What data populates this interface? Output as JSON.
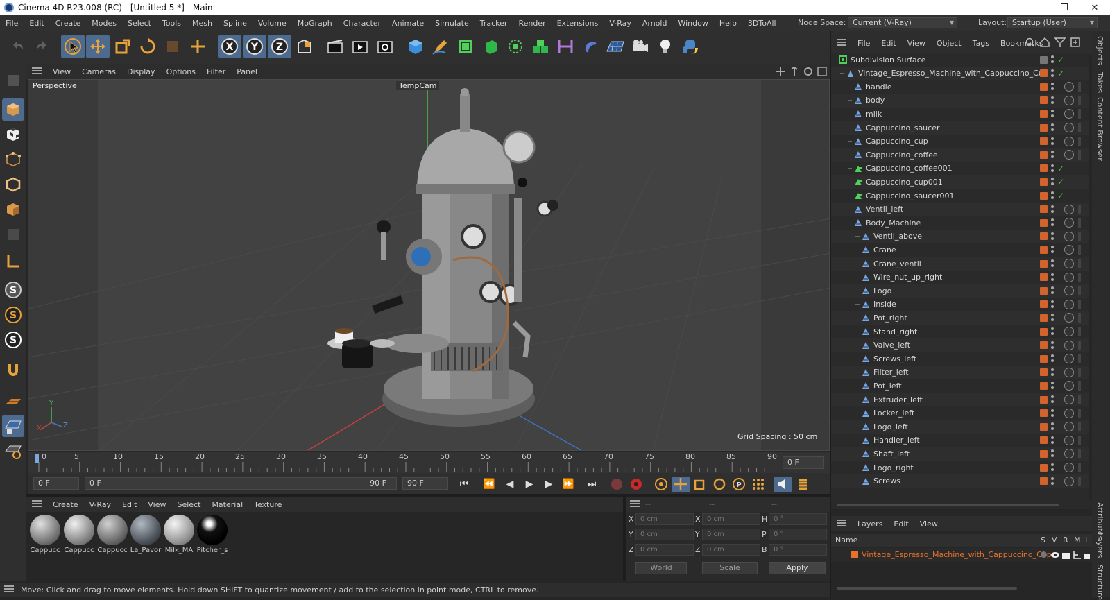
{
  "window": {
    "title": "Cinema 4D R23.008 (RC) - [Untitled 5 *] - Main",
    "minimize": "—",
    "restore": "❐",
    "close": "✕"
  },
  "menu": [
    "File",
    "Edit",
    "Create",
    "Modes",
    "Select",
    "Tools",
    "Mesh",
    "Spline",
    "Volume",
    "MoGraph",
    "Character",
    "Animate",
    "Simulate",
    "Tracker",
    "Render",
    "Extensions",
    "V-Ray",
    "Arnold",
    "Window",
    "Help",
    "3DToAll"
  ],
  "nodespace": {
    "label": "Node Space:",
    "value": "Current (V-Ray)"
  },
  "layout": {
    "label": "Layout:",
    "value": "Startup (User)"
  },
  "viewport": {
    "menu": [
      "View",
      "Cameras",
      "Display",
      "Options",
      "Filter",
      "Panel"
    ],
    "view_name": "Perspective",
    "camera_name": "TempCam",
    "grid_spacing": "Grid Spacing : 50 cm",
    "axis_y": "Y",
    "axis_x": "X",
    "axis_z": "Z"
  },
  "timeline": {
    "ticks": [
      "0",
      "5",
      "10",
      "15",
      "20",
      "25",
      "30",
      "35",
      "40",
      "45",
      "50",
      "55",
      "60",
      "65",
      "70",
      "75",
      "80",
      "85",
      "90"
    ],
    "current_frame": "0 F",
    "start_frame": "0 F",
    "range_start": "0 F",
    "range_end": "90 F",
    "end_frame": "90 F"
  },
  "materials": {
    "menu": [
      "Create",
      "V-Ray",
      "Edit",
      "View",
      "Select",
      "Material",
      "Texture"
    ],
    "items": [
      {
        "name": "Cappucc",
        "color": "#8a8a8a"
      },
      {
        "name": "Cappucc",
        "color": "#9a9a9a"
      },
      {
        "name": "Cappucc",
        "color": "#7f7f7f"
      },
      {
        "name": "La_Pavor",
        "color": "#6f6f6f"
      },
      {
        "name": "Milk_MA",
        "color": "#a0a0a0"
      },
      {
        "name": "Pitcher_s",
        "color": "#1a1a1a"
      }
    ]
  },
  "coords": {
    "header": [
      "--",
      "--",
      "--"
    ],
    "rows": [
      {
        "a": "X",
        "av": "0 cm",
        "b": "X",
        "bv": "0 cm",
        "c": "H",
        "cv": "0 °"
      },
      {
        "a": "Y",
        "av": "0 cm",
        "b": "Y",
        "bv": "0 cm",
        "c": "P",
        "cv": "0 °"
      },
      {
        "a": "Z",
        "av": "0 cm",
        "b": "Z",
        "bv": "0 cm",
        "c": "B",
        "cv": "0 °"
      }
    ],
    "world": "World",
    "scale": "Scale",
    "apply": "Apply"
  },
  "status": "Move: Click and drag to move elements. Hold down SHIFT to quantize movement / add to the selection in point mode, CTRL to remove.",
  "objects": {
    "menu": [
      "File",
      "Edit",
      "View",
      "Object",
      "Tags",
      "Bookmarks"
    ],
    "items": [
      {
        "name": "Subdivision Surface",
        "depth": 0,
        "type": "subdiv"
      },
      {
        "name": "Vintage_Espresso_Machine_with_Cappuccino_Cup",
        "depth": 1,
        "type": "null"
      },
      {
        "name": "handle",
        "depth": 2,
        "type": "poly"
      },
      {
        "name": "body",
        "depth": 2,
        "type": "poly"
      },
      {
        "name": "milk",
        "depth": 2,
        "type": "poly"
      },
      {
        "name": "Cappuccino_saucer",
        "depth": 2,
        "type": "poly"
      },
      {
        "name": "Cappuccino_cup",
        "depth": 2,
        "type": "poly"
      },
      {
        "name": "Cappuccino_coffee",
        "depth": 2,
        "type": "poly"
      },
      {
        "name": "Cappuccino_coffee001",
        "depth": 2,
        "type": "green"
      },
      {
        "name": "Cappuccino_cup001",
        "depth": 2,
        "type": "green"
      },
      {
        "name": "Cappuccino_saucer001",
        "depth": 2,
        "type": "green"
      },
      {
        "name": "Ventil_left",
        "depth": 2,
        "type": "poly"
      },
      {
        "name": "Body_Machine",
        "depth": 2,
        "type": "poly"
      },
      {
        "name": "Ventil_above",
        "depth": 3,
        "type": "poly"
      },
      {
        "name": "Crane",
        "depth": 3,
        "type": "poly"
      },
      {
        "name": "Crane_ventil",
        "depth": 3,
        "type": "poly"
      },
      {
        "name": "Wire_nut_up_right",
        "depth": 3,
        "type": "poly"
      },
      {
        "name": "Logo",
        "depth": 3,
        "type": "poly"
      },
      {
        "name": "Inside",
        "depth": 3,
        "type": "poly"
      },
      {
        "name": "Pot_right",
        "depth": 3,
        "type": "poly"
      },
      {
        "name": "Stand_right",
        "depth": 3,
        "type": "poly"
      },
      {
        "name": "Valve_left",
        "depth": 3,
        "type": "poly"
      },
      {
        "name": "Screws_left",
        "depth": 3,
        "type": "poly"
      },
      {
        "name": "Filter_left",
        "depth": 3,
        "type": "poly"
      },
      {
        "name": "Pot_left",
        "depth": 3,
        "type": "poly"
      },
      {
        "name": "Extruder_left",
        "depth": 3,
        "type": "poly"
      },
      {
        "name": "Locker_left",
        "depth": 3,
        "type": "poly"
      },
      {
        "name": "Logo_left",
        "depth": 3,
        "type": "poly"
      },
      {
        "name": "Handler_left",
        "depth": 3,
        "type": "poly"
      },
      {
        "name": "Shaft_left",
        "depth": 3,
        "type": "poly"
      },
      {
        "name": "Logo_right",
        "depth": 3,
        "type": "poly"
      },
      {
        "name": "Screws",
        "depth": 3,
        "type": "poly"
      }
    ]
  },
  "layers": {
    "menu": [
      "Layers",
      "Edit",
      "View"
    ],
    "col_name": "Name",
    "cols": [
      "S",
      "V",
      "R",
      "M",
      "L"
    ],
    "row": "Vintage_Espresso_Machine_with_Cappuccino_Cup",
    "row_color": "#e8722a"
  },
  "righttabs": [
    "Objects",
    "Takes",
    "Content Browser",
    "Attributes",
    "Layers",
    "Structure"
  ],
  "colors": {
    "accent": "#4d6b8f",
    "object_tag": "#d2632c",
    "check": "#58c23c"
  }
}
